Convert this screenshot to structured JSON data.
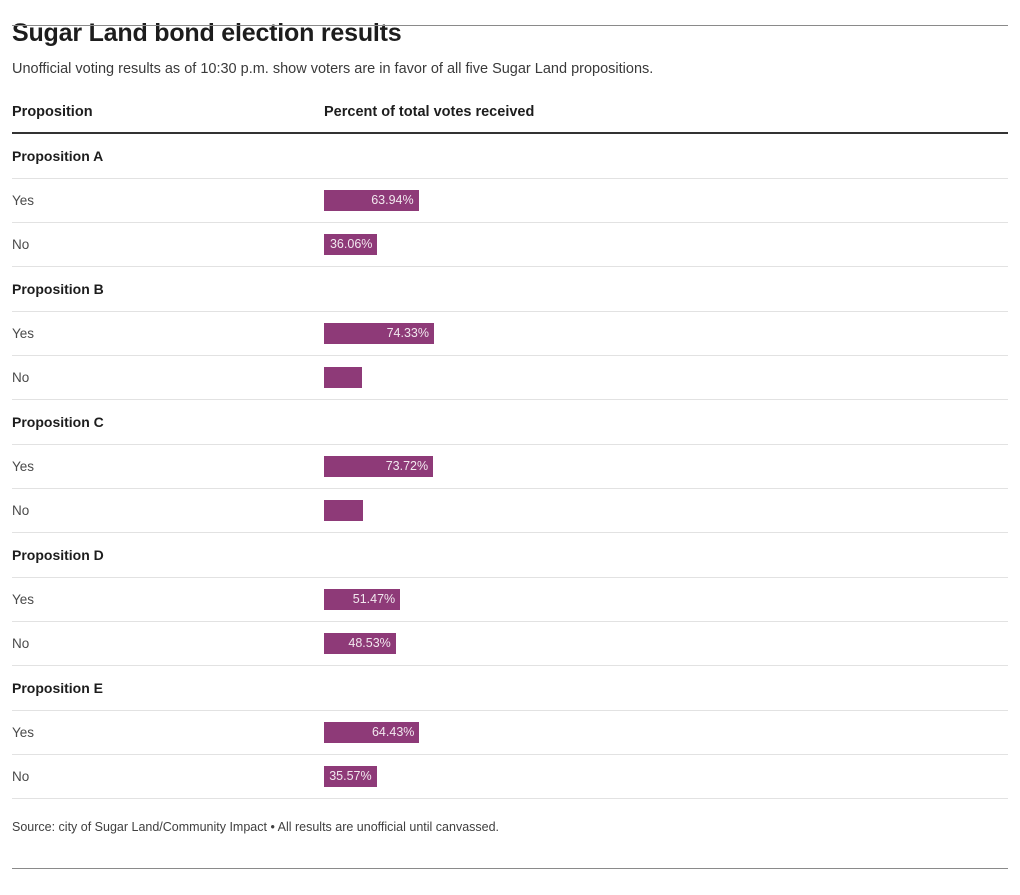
{
  "header": {
    "title": "Sugar Land bond election results",
    "subtitle": "Unofficial voting results as of 10:30 p.m. show voters are in favor of all five Sugar Land propositions."
  },
  "table": {
    "columns": {
      "proposition": "Proposition",
      "percent": "Percent of total votes received"
    }
  },
  "footer": {
    "source": "Source: city of Sugar Land/Community Impact • All results are unofficial until canvassed."
  },
  "colors": {
    "bar": "#8e3a78",
    "bar_label": "#f2e8ef",
    "header_rule": "#333333",
    "row_divider": "#e2e2e2",
    "page_rule": "#8a8a8a"
  },
  "chart_data": {
    "type": "bar",
    "title": "Sugar Land bond election results",
    "subtitle": "Unofficial voting results as of 10:30 p.m. show voters are in favor of all five Sugar Land propositions.",
    "xlabel": "Percent of total votes received",
    "ylabel": "Proposition",
    "orientation": "horizontal",
    "xlim": [
      0,
      100
    ],
    "grid": false,
    "legend": "none",
    "unit": "%",
    "source": "Source: city of Sugar Land/Community Impact • All results are unofficial until canvassed.",
    "groups": [
      {
        "name": "Proposition A",
        "rows": [
          {
            "label": "Yes",
            "value": 63.94,
            "display": "63.94%",
            "label_visible": true
          },
          {
            "label": "No",
            "value": 36.06,
            "display": "36.06%",
            "label_visible": true
          }
        ]
      },
      {
        "name": "Proposition B",
        "rows": [
          {
            "label": "Yes",
            "value": 74.33,
            "display": "74.33%",
            "label_visible": true
          },
          {
            "label": "No",
            "value": 25.67,
            "display": "25.67%",
            "label_visible": false
          }
        ]
      },
      {
        "name": "Proposition C",
        "rows": [
          {
            "label": "Yes",
            "value": 73.72,
            "display": "73.72%",
            "label_visible": true
          },
          {
            "label": "No",
            "value": 26.28,
            "display": "26.28%",
            "label_visible": false
          }
        ]
      },
      {
        "name": "Proposition D",
        "rows": [
          {
            "label": "Yes",
            "value": 51.47,
            "display": "51.47%",
            "label_visible": true
          },
          {
            "label": "No",
            "value": 48.53,
            "display": "48.53%",
            "label_visible": true
          }
        ]
      },
      {
        "name": "Proposition E",
        "rows": [
          {
            "label": "Yes",
            "value": 64.43,
            "display": "64.43%",
            "label_visible": true
          },
          {
            "label": "No",
            "value": 35.57,
            "display": "35.57%",
            "label_visible": true
          }
        ]
      }
    ]
  }
}
